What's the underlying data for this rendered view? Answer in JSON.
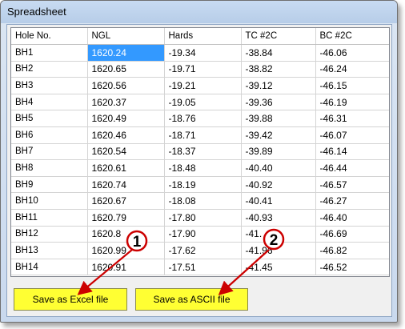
{
  "window": {
    "title": "Spreadsheet"
  },
  "table": {
    "headers": [
      "Hole No.",
      "NGL",
      "Hards",
      "TC #2C",
      "BC #2C"
    ],
    "rows": [
      [
        "BH1",
        "1620.24",
        "-19.34",
        "-38.84",
        "-46.06"
      ],
      [
        "BH2",
        "1620.65",
        "-19.71",
        "-38.82",
        "-46.24"
      ],
      [
        "BH3",
        "1620.56",
        "-19.21",
        "-39.12",
        "-46.15"
      ],
      [
        "BH4",
        "1620.37",
        "-19.05",
        "-39.36",
        "-46.19"
      ],
      [
        "BH5",
        "1620.49",
        "-18.76",
        "-39.88",
        "-46.31"
      ],
      [
        "BH6",
        "1620.46",
        "-18.71",
        "-39.42",
        "-46.07"
      ],
      [
        "BH7",
        "1620.54",
        "-18.37",
        "-39.89",
        "-46.14"
      ],
      [
        "BH8",
        "1620.61",
        "-18.48",
        "-40.40",
        "-46.44"
      ],
      [
        "BH9",
        "1620.74",
        "-18.19",
        "-40.92",
        "-46.57"
      ],
      [
        "BH10",
        "1620.67",
        "-18.08",
        "-40.41",
        "-46.27"
      ],
      [
        "BH11",
        "1620.79",
        "-17.80",
        "-40.93",
        "-46.40"
      ],
      [
        "BH12",
        "1620.8",
        "-17.90",
        "-41.",
        "-46.69"
      ],
      [
        "BH13",
        "1620.99",
        "-17.62",
        "-41.96",
        "-46.82"
      ],
      [
        "BH14",
        "1620.91",
        "-17.51",
        "-41.45",
        "-46.52"
      ]
    ],
    "selected_cell": {
      "row": 0,
      "col": 1
    }
  },
  "buttons": {
    "save_excel": "Save as Excel file",
    "save_ascii": "Save as ASCII file"
  },
  "callouts": {
    "one": {
      "label": "1"
    },
    "two": {
      "label": "2"
    }
  },
  "colors": {
    "button_bg": "#ffff33",
    "selection": "#3399ff",
    "callout_arrow": "#cc0000"
  }
}
